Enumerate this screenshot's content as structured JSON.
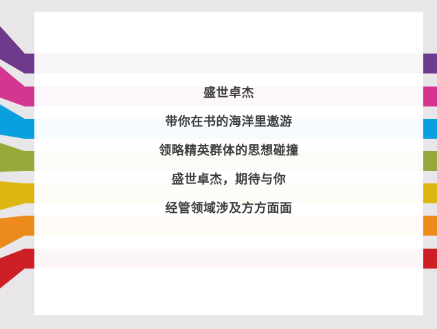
{
  "slide": {
    "lines": [
      "盛世卓杰",
      "带你在书的海洋里遨游",
      "领略精英群体的思想碰撞",
      "盛世卓杰，期待与你",
      "经管领域涉及方方面面"
    ]
  },
  "colors": {
    "purple": "#6f3a8c",
    "magenta": "#d4358e",
    "blue": "#0aa0e0",
    "olive": "#98a83a",
    "yellow": "#ddb611",
    "orange": "#ec8a1b",
    "red": "#cc1f26",
    "text": "#3d3d3d",
    "background": "#e8e6e8",
    "card": "#ffffff"
  }
}
